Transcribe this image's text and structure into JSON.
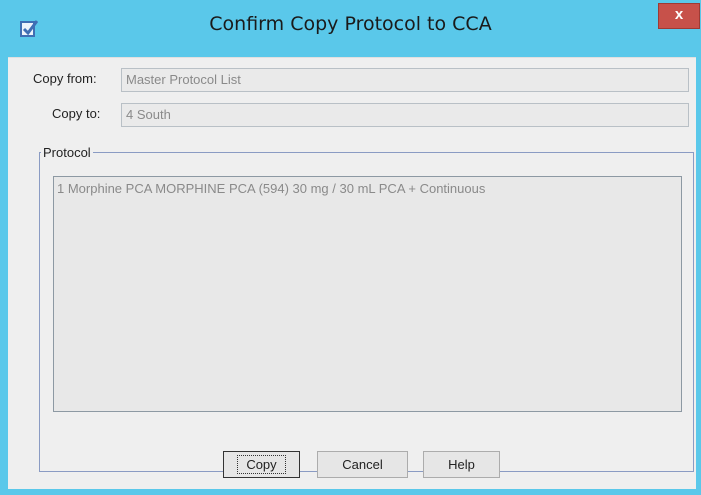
{
  "window": {
    "title": "Confirm Copy Protocol to CCA",
    "close_glyph": "x",
    "icon": "app-checkbox-icon"
  },
  "form": {
    "copy_from_label": "Copy from:",
    "copy_from_value": "Master Protocol List",
    "copy_to_label": "Copy to:",
    "copy_to_value": "4 South"
  },
  "protocol": {
    "group_label": "Protocol",
    "items": [
      "1 Morphine PCA MORPHINE PCA (594) 30 mg / 30 mL PCA + Continuous"
    ]
  },
  "buttons": {
    "copy_label": "Copy",
    "cancel_label": "Cancel",
    "help_label": "Help"
  },
  "colors": {
    "titlebar": "#5ac8ea",
    "close_button": "#c7514a",
    "client_bg": "#efefef",
    "groupbox_border": "#8a9bc3"
  }
}
